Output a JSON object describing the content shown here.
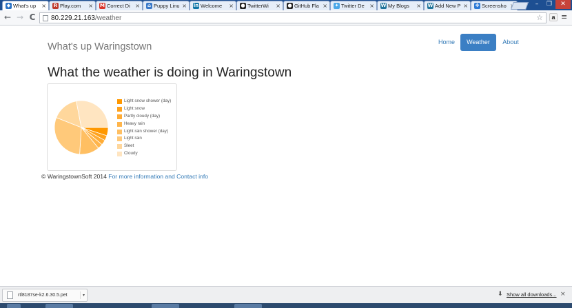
{
  "browser": {
    "tabs": [
      {
        "label": "What's up",
        "icon": "code-arrows-icon",
        "color": "#2b73c6",
        "glyph": "◆",
        "active": true
      },
      {
        "label": "Play.com",
        "icon": "r-logo-icon",
        "color": "#c0392b",
        "glyph": "R",
        "active": false
      },
      {
        "label": "Correct Di",
        "icon": "gmail-icon",
        "color": "#d9342b",
        "glyph": "M",
        "active": false
      },
      {
        "label": "Puppy Linu",
        "icon": "house-icon",
        "color": "#3a79c9",
        "glyph": "⌂",
        "active": false
      },
      {
        "label": "Welcome",
        "icon": "linkedin-icon",
        "color": "#0e76a8",
        "glyph": "in",
        "active": false
      },
      {
        "label": "TwitterWi",
        "icon": "github-icon",
        "color": "#222222",
        "glyph": "●",
        "active": false
      },
      {
        "label": "GitHub Fla",
        "icon": "github-icon",
        "color": "#222222",
        "glyph": "●",
        "active": false
      },
      {
        "label": "Twitter De",
        "icon": "twitter-bird-icon",
        "color": "#4aa7e8",
        "glyph": "✦",
        "active": false
      },
      {
        "label": "My Blogs",
        "icon": "wordpress-icon",
        "color": "#21759b",
        "glyph": "W",
        "active": false
      },
      {
        "label": "Add New P",
        "icon": "wordpress-icon",
        "color": "#21759b",
        "glyph": "W",
        "active": false
      },
      {
        "label": "Screensho",
        "icon": "dropbox-icon",
        "color": "#2d7ad6",
        "glyph": "✥",
        "active": false
      }
    ],
    "close_glyph": "×",
    "window_controls": {
      "minimize": "–",
      "restore": "❐",
      "close": "✕"
    },
    "nav": {
      "back": "←",
      "forward": "→",
      "reload": "C"
    },
    "url_host": "80.229.21.163",
    "url_path": "/weather",
    "star_glyph": "☆",
    "amazon_glyph": "a",
    "menu_glyph": "≡"
  },
  "site": {
    "brand": "What's up Waringstown",
    "nav": [
      {
        "label": "Home",
        "active": false
      },
      {
        "label": "Weather",
        "active": true
      },
      {
        "label": "About",
        "active": false
      }
    ],
    "heading": "What the weather is doing in Waringstown",
    "footer_text": "© WaringstownSoft 2014 ",
    "footer_link": "For more information and Contact info"
  },
  "chart_data": {
    "type": "pie",
    "series": [
      {
        "label": "Light snow shower (day)",
        "value": 5,
        "color": "#ff9800"
      },
      {
        "label": "Light snow",
        "value": 3,
        "color": "#ffa21d"
      },
      {
        "label": "Partly cloudy (day)",
        "value": 3,
        "color": "#ffac35"
      },
      {
        "label": "Heavy rain",
        "value": 3,
        "color": "#ffb54b"
      },
      {
        "label": "Light rain shower (day)",
        "value": 12,
        "color": "#ffbf62"
      },
      {
        "label": "Light rain",
        "value": 30,
        "color": "#ffc97a"
      },
      {
        "label": "Sleet",
        "value": 16,
        "color": "#ffd79c"
      },
      {
        "label": "Cloudy",
        "value": 28,
        "color": "#ffe5c1"
      }
    ]
  },
  "downloads": {
    "file_name": "rtl8187se-k2.6.30.5.pet",
    "dropdown_glyph": "▾",
    "show_all": "Show all downloads...",
    "download_glyph": "⬇",
    "close_glyph": "×"
  }
}
